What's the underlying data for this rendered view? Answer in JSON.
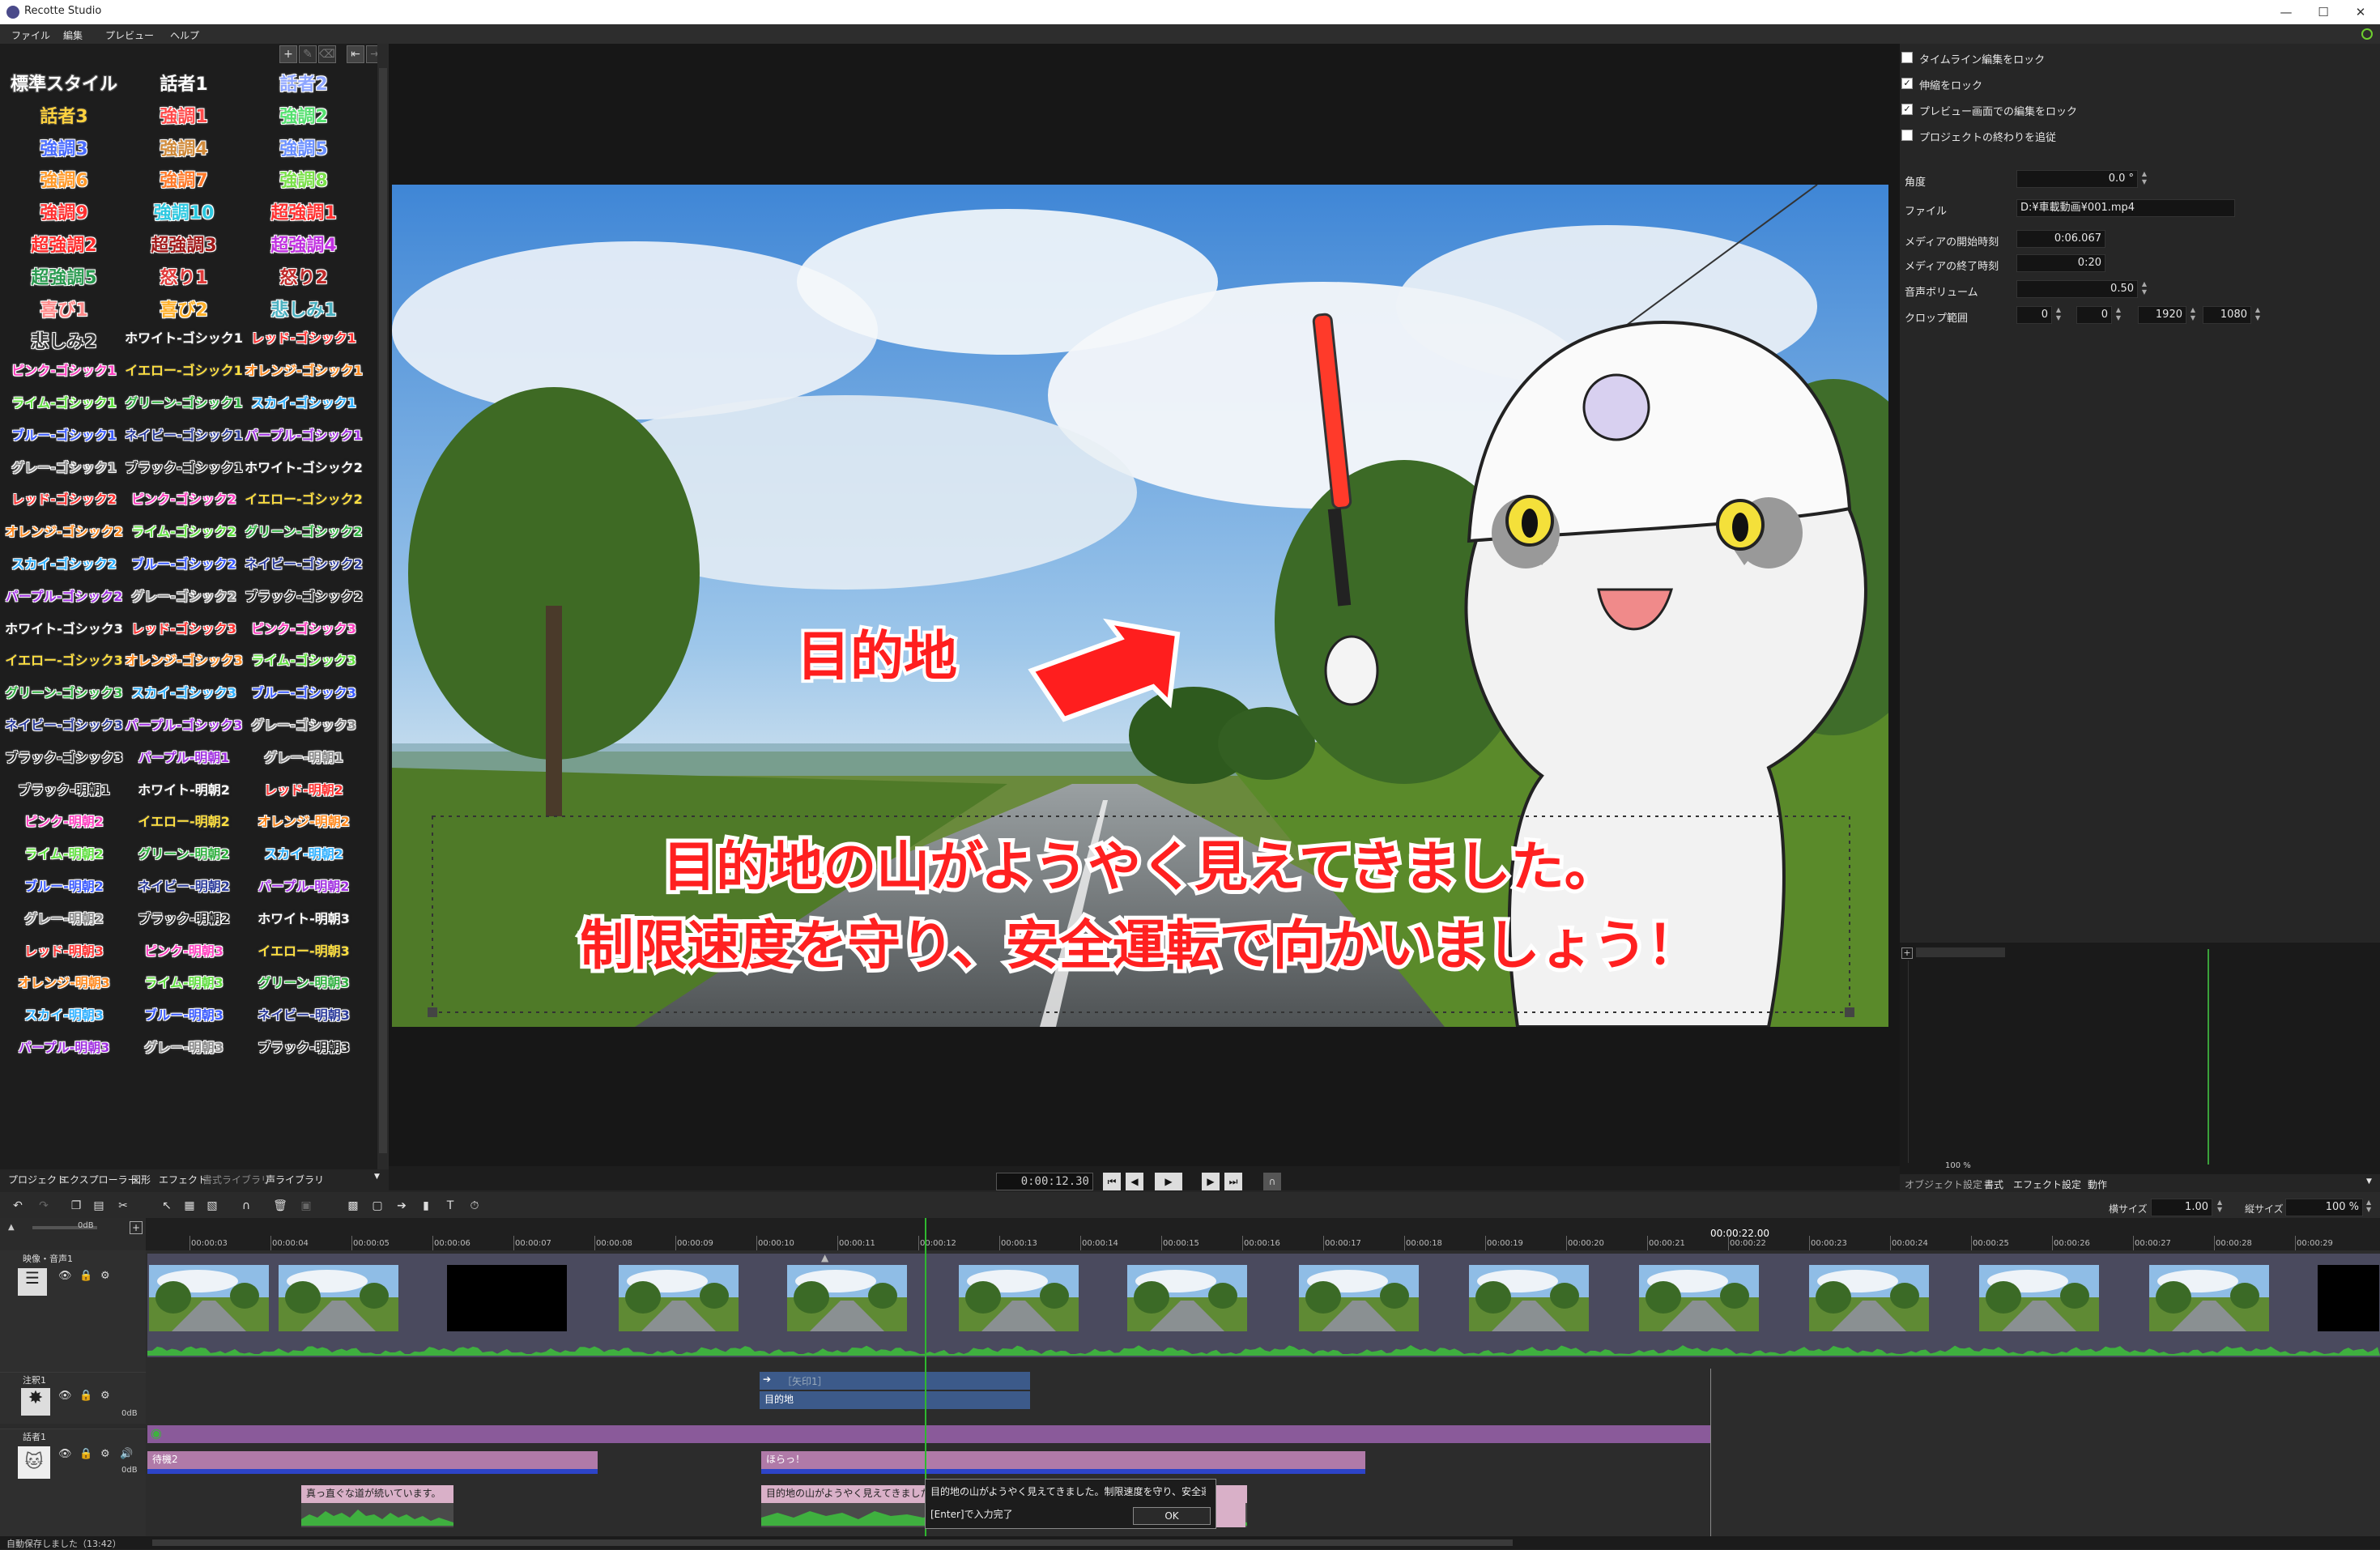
{
  "window": {
    "title": "Recotte Studio"
  },
  "menu": [
    "ファイル",
    "編集",
    "プレビュー",
    "ヘルプ"
  ],
  "styles": [
    [
      {
        "t": "標準スタイル",
        "c": "#ffffff",
        "o": "#555"
      },
      {
        "t": "話者1",
        "c": "#ffffff",
        "o": "#333"
      },
      {
        "t": "話者2",
        "c": "#8fa6ff",
        "o": "#fff"
      }
    ],
    [
      {
        "t": "話者3",
        "c": "#ffd23f",
        "o": "#333"
      },
      {
        "t": "強調1",
        "c": "#ff4a4a",
        "o": "#fff"
      },
      {
        "t": "強調2",
        "c": "#55e070",
        "o": "#fff"
      }
    ],
    [
      {
        "t": "強調3",
        "c": "#4a6cff",
        "o": "#fff"
      },
      {
        "t": "強調4",
        "c": "#d08a3a",
        "o": "#fff"
      },
      {
        "t": "強調5",
        "c": "#6a8fff",
        "o": "#fff"
      }
    ],
    [
      {
        "t": "強調6",
        "c": "#ff9a2a",
        "o": "#fff"
      },
      {
        "t": "強調7",
        "c": "#ff7a2a",
        "o": "#fff"
      },
      {
        "t": "強調8",
        "c": "#7ae04a",
        "o": "#fff"
      }
    ],
    [
      {
        "t": "強調9",
        "c": "#ff3030",
        "o": "#fff"
      },
      {
        "t": "強調10",
        "c": "#2ec8e0",
        "o": "#fff"
      },
      {
        "t": "超強調1",
        "c": "#ff3030",
        "o": "#fff"
      }
    ],
    [
      {
        "t": "超強調2",
        "c": "#ff2a2a",
        "o": "#fff"
      },
      {
        "t": "超強調3",
        "c": "#a01818",
        "o": "#fff"
      },
      {
        "t": "超強調4",
        "c": "#c030e0",
        "o": "#fff"
      }
    ],
    [
      {
        "t": "超強調5",
        "c": "#2a9a50",
        "o": "#fff"
      },
      {
        "t": "怒り1",
        "c": "#e03a3a",
        "o": "#fff"
      },
      {
        "t": "怒り2",
        "c": "#c02a2a",
        "o": "#fff"
      }
    ],
    [
      {
        "t": "喜び1",
        "c": "#ff8a8a",
        "o": "#fff"
      },
      {
        "t": "喜び2",
        "c": "#ffb02a",
        "o": "#fff"
      },
      {
        "t": "悲しみ1",
        "c": "#4ab0c0",
        "o": "#fff"
      }
    ],
    [
      {
        "t": "悲しみ2",
        "c": "#333333",
        "o": "#fff"
      },
      {
        "t": "ホワイト-ゴシック1",
        "c": "#ffffff",
        "o": "#333"
      },
      {
        "t": "レッド-ゴシック1",
        "c": "#ff3030",
        "o": "#fff"
      }
    ],
    [
      {
        "t": "ピンク-ゴシック1",
        "c": "#ff40c0",
        "o": "#fff"
      },
      {
        "t": "イエロー-ゴシック1",
        "c": "#ffe040",
        "o": "#333"
      },
      {
        "t": "オレンジ-ゴシック1",
        "c": "#ff8a20",
        "o": "#fff"
      }
    ],
    [
      {
        "t": "ライム-ゴシック1",
        "c": "#60e040",
        "o": "#fff"
      },
      {
        "t": "グリーン-ゴシック1",
        "c": "#30b040",
        "o": "#fff"
      },
      {
        "t": "スカイ-ゴシック1",
        "c": "#30b0ff",
        "o": "#fff"
      }
    ],
    [
      {
        "t": "ブルー-ゴシック1",
        "c": "#3a5aff",
        "o": "#fff"
      },
      {
        "t": "ネイビー-ゴシック1",
        "c": "#2a3a9a",
        "o": "#fff"
      },
      {
        "t": "パープル-ゴシック1",
        "c": "#a030e0",
        "o": "#fff"
      }
    ],
    [
      {
        "t": "グレー-ゴシック1",
        "c": "#888888",
        "o": "#fff"
      },
      {
        "t": "ブラック-ゴシック1",
        "c": "#222222",
        "o": "#fff"
      },
      {
        "t": "ホワイト-ゴシック2",
        "c": "#ffffff",
        "o": "#333"
      }
    ],
    [
      {
        "t": "レッド-ゴシック2",
        "c": "#ff3030",
        "o": "#fff"
      },
      {
        "t": "ピンク-ゴシック2",
        "c": "#ff40c0",
        "o": "#fff"
      },
      {
        "t": "イエロー-ゴシック2",
        "c": "#ffe040",
        "o": "#333"
      }
    ],
    [
      {
        "t": "オレンジ-ゴシック2",
        "c": "#ff8a20",
        "o": "#fff"
      },
      {
        "t": "ライム-ゴシック2",
        "c": "#60e040",
        "o": "#fff"
      },
      {
        "t": "グリーン-ゴシック2",
        "c": "#30b040",
        "o": "#fff"
      }
    ],
    [
      {
        "t": "スカイ-ゴシック2",
        "c": "#30b0ff",
        "o": "#fff"
      },
      {
        "t": "ブルー-ゴシック2",
        "c": "#3a5aff",
        "o": "#fff"
      },
      {
        "t": "ネイビー-ゴシック2",
        "c": "#2a3a9a",
        "o": "#fff"
      }
    ],
    [
      {
        "t": "パープル-ゴシック2",
        "c": "#a030e0",
        "o": "#fff"
      },
      {
        "t": "グレー-ゴシック2",
        "c": "#888888",
        "o": "#fff"
      },
      {
        "t": "ブラック-ゴシック2",
        "c": "#222222",
        "o": "#fff"
      }
    ],
    [
      {
        "t": "ホワイト-ゴシック3",
        "c": "#ffffff",
        "o": "#333"
      },
      {
        "t": "レッド-ゴシック3",
        "c": "#ff3030",
        "o": "#fff"
      },
      {
        "t": "ピンク-ゴシック3",
        "c": "#ff40c0",
        "o": "#fff"
      }
    ],
    [
      {
        "t": "イエロー-ゴシック3",
        "c": "#ffe040",
        "o": "#333"
      },
      {
        "t": "オレンジ-ゴシック3",
        "c": "#ff8a20",
        "o": "#fff"
      },
      {
        "t": "ライム-ゴシック3",
        "c": "#60e040",
        "o": "#fff"
      }
    ],
    [
      {
        "t": "グリーン-ゴシック3",
        "c": "#30b040",
        "o": "#fff"
      },
      {
        "t": "スカイ-ゴシック3",
        "c": "#30b0ff",
        "o": "#fff"
      },
      {
        "t": "ブルー-ゴシック3",
        "c": "#3a5aff",
        "o": "#fff"
      }
    ],
    [
      {
        "t": "ネイビー-ゴシック3",
        "c": "#2a3a9a",
        "o": "#fff"
      },
      {
        "t": "パープル-ゴシック3",
        "c": "#a030e0",
        "o": "#fff"
      },
      {
        "t": "グレー-ゴシック3",
        "c": "#888888",
        "o": "#fff"
      }
    ],
    [
      {
        "t": "ブラック-ゴシック3",
        "c": "#222222",
        "o": "#fff"
      },
      {
        "t": "パープル-明朝1",
        "c": "#a030e0",
        "o": "#fff"
      },
      {
        "t": "グレー-明朝1",
        "c": "#888888",
        "o": "#fff"
      }
    ],
    [
      {
        "t": "ブラック-明朝1",
        "c": "#222222",
        "o": "#fff"
      },
      {
        "t": "ホワイト-明朝2",
        "c": "#ffffff",
        "o": "#333"
      },
      {
        "t": "レッド-明朝2",
        "c": "#ff3030",
        "o": "#fff"
      }
    ],
    [
      {
        "t": "ピンク-明朝2",
        "c": "#ff40c0",
        "o": "#fff"
      },
      {
        "t": "イエロー-明朝2",
        "c": "#ffe040",
        "o": "#333"
      },
      {
        "t": "オレンジ-明朝2",
        "c": "#ff8a20",
        "o": "#fff"
      }
    ],
    [
      {
        "t": "ライム-明朝2",
        "c": "#60e040",
        "o": "#fff"
      },
      {
        "t": "グリーン-明朝2",
        "c": "#30b040",
        "o": "#fff"
      },
      {
        "t": "スカイ-明朝2",
        "c": "#30b0ff",
        "o": "#fff"
      }
    ],
    [
      {
        "t": "ブルー-明朝2",
        "c": "#3a5aff",
        "o": "#fff"
      },
      {
        "t": "ネイビー-明朝2",
        "c": "#2a3a9a",
        "o": "#fff"
      },
      {
        "t": "パープル-明朝2",
        "c": "#a030e0",
        "o": "#fff"
      }
    ],
    [
      {
        "t": "グレー-明朝2",
        "c": "#888888",
        "o": "#fff"
      },
      {
        "t": "ブラック-明朝2",
        "c": "#222222",
        "o": "#fff"
      },
      {
        "t": "ホワイト-明朝3",
        "c": "#ffffff",
        "o": "#333"
      }
    ],
    [
      {
        "t": "レッド-明朝3",
        "c": "#ff3030",
        "o": "#fff"
      },
      {
        "t": "ピンク-明朝3",
        "c": "#ff40c0",
        "o": "#fff"
      },
      {
        "t": "イエロー-明朝3",
        "c": "#ffe040",
        "o": "#333"
      }
    ],
    [
      {
        "t": "オレンジ-明朝3",
        "c": "#ff8a20",
        "o": "#fff"
      },
      {
        "t": "ライム-明朝3",
        "c": "#60e040",
        "o": "#fff"
      },
      {
        "t": "グリーン-明朝3",
        "c": "#30b040",
        "o": "#fff"
      }
    ],
    [
      {
        "t": "スカイ-明朝3",
        "c": "#30b0ff",
        "o": "#fff"
      },
      {
        "t": "ブルー-明朝3",
        "c": "#3a5aff",
        "o": "#fff"
      },
      {
        "t": "ネイビー-明朝3",
        "c": "#2a3a9a",
        "o": "#fff"
      }
    ],
    [
      {
        "t": "パープル-明朝3",
        "c": "#a030e0",
        "o": "#fff"
      },
      {
        "t": "グレー-明朝3",
        "c": "#888888",
        "o": "#fff"
      },
      {
        "t": "ブラック-明朝3",
        "c": "#222222",
        "o": "#fff"
      }
    ]
  ],
  "left_tabs": [
    "プロジェクト",
    "エクスプローラー",
    "図形",
    "エフェクト",
    "書式ライブラリ",
    "声ライブラリ"
  ],
  "preview": {
    "label_text": "目的地",
    "caption_line1": "目的地の山がようやく見えてきました。",
    "caption_line2": "制限速度を守り、安全運転で向かいましょう！"
  },
  "playback": {
    "timecode": "0:00:12.30"
  },
  "right": {
    "checkboxes": [
      {
        "label": "タイムライン編集をロック",
        "checked": false
      },
      {
        "label": "伸縮をロック",
        "checked": true
      },
      {
        "label": "プレビュー画面での編集をロック",
        "checked": true
      },
      {
        "label": "プロジェクトの終わりを追従",
        "checked": false
      }
    ],
    "angle_label": "角度",
    "angle_value": "0.0 °",
    "file_label": "ファイル",
    "file_value": "D:¥車載動画¥001.mp4",
    "media_start_label": "メディアの開始時刻",
    "media_start_value": "0:06.067",
    "media_end_label": "メディアの終了時刻",
    "media_end_value": "0:20",
    "volume_label": "音声ボリューム",
    "volume_value": "0.50",
    "crop_label": "クロップ範囲",
    "crop_values": [
      "0",
      "0",
      "1920",
      "1080"
    ],
    "graph_zoom": "100 %"
  },
  "right_tabs": [
    "オブジェクト設定",
    "書式",
    "エフェクト設定",
    "動作"
  ],
  "timeline_tools": {
    "hsize_label": "横サイズ",
    "hsize_value": "1.00",
    "vsize_label": "縦サイズ",
    "vsize_value": "100 %"
  },
  "ruler": {
    "current": "00:00:22.00",
    "ticks": [
      "00:00:03",
      "00:00:04",
      "00:00:05",
      "00:00:06",
      "00:00:07",
      "00:00:08",
      "00:00:09",
      "00:00:10",
      "00:00:11",
      "00:00:12",
      "00:00:13",
      "00:00:14",
      "00:00:15",
      "00:00:16",
      "00:00:17",
      "00:00:18",
      "00:00:19",
      "00:00:20",
      "00:00:21",
      "00:00:22",
      "00:00:23",
      "00:00:24",
      "00:00:25",
      "00:00:26",
      "00:00:27",
      "00:00:28",
      "00:00:29"
    ]
  },
  "tracks": {
    "video_name": "映像・音声1",
    "annot_name": "注釈1",
    "speaker_name": "話者1",
    "db_label": "0dB",
    "arrow_clip": "［矢印1］",
    "label_clip": "目的地",
    "clip_a": "待機2",
    "clip_b": "ほらっ！",
    "clip_c": "真っ直ぐな道が続いています。",
    "clip_d": "目的地の山がようやく見えてきました。制限速度を守り、安全",
    "dialog_text": "目的地の山がようやく見えてきました。制限速度を守り、安全運",
    "dialog_hint": "[Enter]で入力完了",
    "dialog_ok": "OK"
  },
  "status": "自動保存しました（13:42）"
}
